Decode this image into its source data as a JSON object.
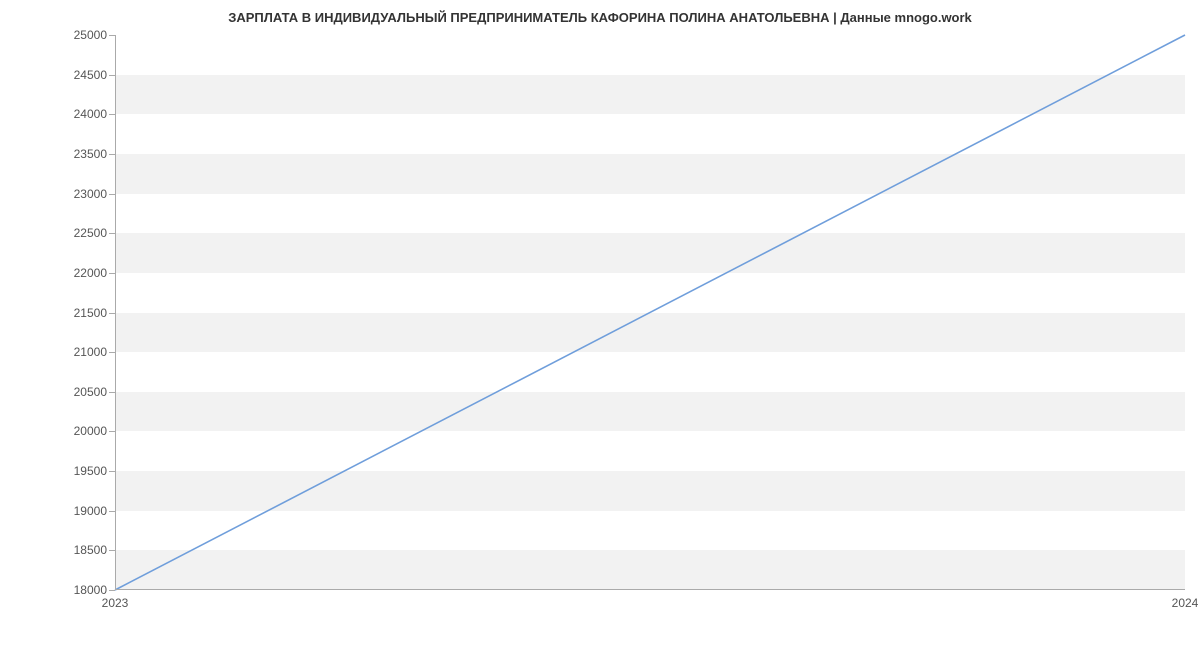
{
  "title": "ЗАРПЛАТА В ИНДИВИДУАЛЬНЫЙ ПРЕДПРИНИМАТЕЛЬ КАФОРИНА ПОЛИНА АНАТОЛЬЕВНА | Данные mnogo.work",
  "chart_data": {
    "type": "line",
    "x": [
      "2023",
      "2024"
    ],
    "series": [
      {
        "name": "salary",
        "values": [
          18000,
          25000
        ]
      }
    ],
    "title": "ЗАРПЛАТА В ИНДИВИДУАЛЬНЫЙ ПРЕДПРИНИМАТЕЛЬ КАФОРИНА ПОЛИНА АНАТОЛЬЕВНА | Данные mnogo.work",
    "xlabel": "",
    "ylabel": "",
    "ylim": [
      18000,
      25000
    ],
    "y_ticks": [
      18000,
      18500,
      19000,
      19500,
      20000,
      20500,
      21000,
      21500,
      22000,
      22500,
      23000,
      23500,
      24000,
      24500,
      25000
    ],
    "x_ticks": [
      "2023",
      "2024"
    ],
    "grid": true
  }
}
